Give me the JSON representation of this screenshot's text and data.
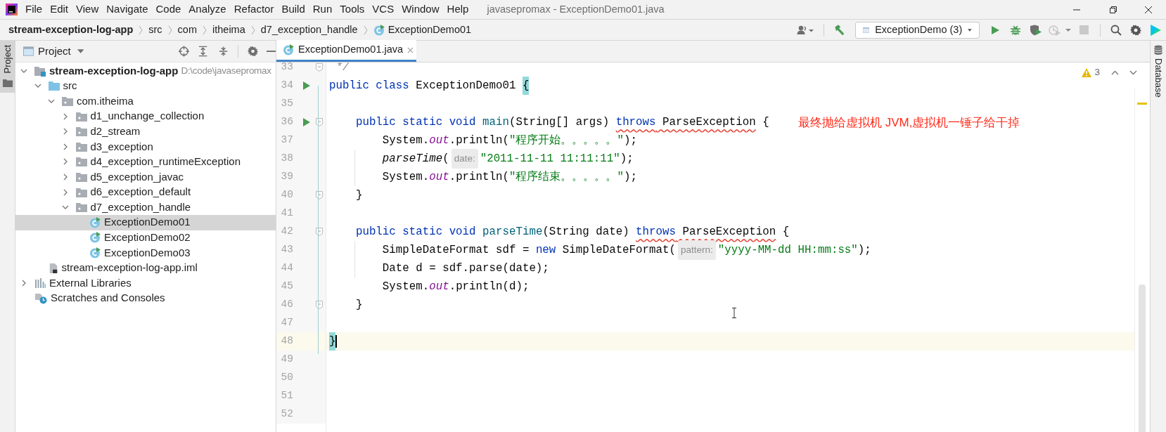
{
  "window": {
    "title": "javasepromax - ExceptionDemo01.java"
  },
  "menu": [
    "File",
    "Edit",
    "View",
    "Navigate",
    "Code",
    "Analyze",
    "Refactor",
    "Build",
    "Run",
    "Tools",
    "VCS",
    "Window",
    "Help"
  ],
  "breadcrumbs": [
    {
      "label": "stream-exception-log-app",
      "kind": "module"
    },
    {
      "label": "src",
      "kind": "folder"
    },
    {
      "label": "com",
      "kind": "folder"
    },
    {
      "label": "itheima",
      "kind": "folder"
    },
    {
      "label": "d7_exception_handle",
      "kind": "folder"
    },
    {
      "label": "ExceptionDemo01",
      "kind": "class"
    }
  ],
  "run_config": {
    "label": "ExceptionDemo (3)"
  },
  "side_tabs": {
    "left": "Project",
    "right": "Database"
  },
  "project_panel": {
    "title": "Project",
    "tree": [
      {
        "label": "stream-exception-log-app",
        "path": "D:\\code\\javasepromax",
        "kind": "module",
        "expanded": true,
        "selected": false,
        "children": [
          {
            "label": "src",
            "kind": "source_folder",
            "expanded": true,
            "selected": false,
            "children": [
              {
                "label": "com.itheima",
                "kind": "package",
                "expanded": true,
                "selected": false,
                "children": [
                  {
                    "label": "d1_unchange_collection",
                    "kind": "package",
                    "expanded": false,
                    "selected": false
                  },
                  {
                    "label": "d2_stream",
                    "kind": "package",
                    "expanded": false,
                    "selected": false
                  },
                  {
                    "label": "d3_exception",
                    "kind": "package",
                    "expanded": false,
                    "selected": false
                  },
                  {
                    "label": "d4_exception_runtimeException",
                    "kind": "package",
                    "expanded": false,
                    "selected": false
                  },
                  {
                    "label": "d5_exception_javac",
                    "kind": "package",
                    "expanded": false,
                    "selected": false
                  },
                  {
                    "label": "d6_exception_default",
                    "kind": "package",
                    "expanded": false,
                    "selected": false
                  },
                  {
                    "label": "d7_exception_handle",
                    "kind": "package",
                    "expanded": true,
                    "selected": false,
                    "children": [
                      {
                        "label": "ExceptionDemo01",
                        "kind": "class",
                        "selected": true
                      },
                      {
                        "label": "ExceptionDemo02",
                        "kind": "class",
                        "selected": false
                      },
                      {
                        "label": "ExceptionDemo03",
                        "kind": "class",
                        "selected": false
                      }
                    ]
                  }
                ]
              }
            ]
          },
          {
            "label": "stream-exception-log-app.iml",
            "kind": "iml",
            "selected": false
          }
        ]
      },
      {
        "label": "External Libraries",
        "kind": "libraries",
        "expanded": false,
        "selected": false
      },
      {
        "label": "Scratches and Consoles",
        "kind": "scratches",
        "selected": false
      }
    ]
  },
  "editor": {
    "tab": {
      "label": "ExceptionDemo01.java",
      "selected": true
    },
    "warnings": "3",
    "lines": [
      {
        "number": "33",
        "run": false,
        "fold": true,
        "current": false,
        "tokens": [
          {
            "kind": "comment",
            "text": " */"
          }
        ]
      },
      {
        "number": "34",
        "run": true,
        "fold": false,
        "current": false,
        "tokens": [
          {
            "kind": "keyword",
            "text": "public class "
          },
          {
            "kind": "plain",
            "text": "ExceptionDemo01 "
          },
          {
            "kind": "brace_match",
            "text": "{"
          }
        ]
      },
      {
        "number": "35",
        "run": false,
        "fold": false,
        "current": false
      },
      {
        "number": "36",
        "run": true,
        "fold": true,
        "current": false,
        "annotation": "最终抛给虚拟机 JVM,虚拟机一锤子给干掉",
        "tokens": [
          {
            "kind": "keyword",
            "text": "    public static void "
          },
          {
            "kind": "method_decl",
            "text": "main"
          },
          {
            "kind": "plain",
            "text": "(String[] args) "
          },
          {
            "kind": "flagged",
            "tokens": [
              {
                "kind": "keyword",
                "text": "throws"
              },
              {
                "kind": "plain",
                "text": " ParseException"
              }
            ]
          },
          {
            "kind": "plain",
            "text": " {"
          }
        ]
      },
      {
        "number": "37",
        "run": false,
        "fold": false,
        "current": false,
        "tokens": [
          {
            "kind": "plain",
            "text": "        System."
          },
          {
            "kind": "field",
            "text": "out"
          },
          {
            "kind": "plain",
            "text": ".println("
          },
          {
            "kind": "string",
            "text": "\"程序开始。。。。。\""
          },
          {
            "kind": "plain",
            "text": ");"
          }
        ]
      },
      {
        "number": "38",
        "run": false,
        "fold": false,
        "current": false,
        "tokens": [
          {
            "kind": "static_call",
            "text": "        parseTime"
          },
          {
            "kind": "plain",
            "text": "("
          },
          {
            "kind": "hint",
            "text": "date:"
          },
          {
            "kind": "string",
            "text": "\"2011-11-11 11:11:11\""
          },
          {
            "kind": "plain",
            "text": ");"
          }
        ]
      },
      {
        "number": "39",
        "run": false,
        "fold": false,
        "current": false,
        "tokens": [
          {
            "kind": "plain",
            "text": "        System."
          },
          {
            "kind": "field",
            "text": "out"
          },
          {
            "kind": "plain",
            "text": ".println("
          },
          {
            "kind": "string",
            "text": "\"程序结束。。。。。\""
          },
          {
            "kind": "plain",
            "text": ");"
          }
        ]
      },
      {
        "number": "40",
        "run": false,
        "fold": true,
        "current": false,
        "tokens": [
          {
            "kind": "plain",
            "text": "    }"
          }
        ]
      },
      {
        "number": "41",
        "run": false,
        "fold": false,
        "current": false
      },
      {
        "number": "42",
        "run": false,
        "fold": true,
        "current": false,
        "tokens": [
          {
            "kind": "keyword",
            "text": "    public static void "
          },
          {
            "kind": "method_decl",
            "text": "parseTime"
          },
          {
            "kind": "plain",
            "text": "(String date) "
          },
          {
            "kind": "flagged",
            "tokens": [
              {
                "kind": "keyword",
                "text": "throws"
              },
              {
                "kind": "plain",
                "text": " ParseException"
              }
            ]
          },
          {
            "kind": "plain",
            "text": " {"
          }
        ]
      },
      {
        "number": "43",
        "run": false,
        "fold": false,
        "current": false,
        "tokens": [
          {
            "kind": "plain",
            "text": "        SimpleDateFormat sdf = "
          },
          {
            "kind": "keyword",
            "text": "new"
          },
          {
            "kind": "plain",
            "text": " SimpleDateFormat("
          },
          {
            "kind": "hint",
            "text": "pattern:"
          },
          {
            "kind": "string",
            "text": "\"yyyy-MM-dd HH:mm:ss\""
          },
          {
            "kind": "plain",
            "text": ");"
          }
        ]
      },
      {
        "number": "44",
        "run": false,
        "fold": false,
        "current": false,
        "tokens": [
          {
            "kind": "plain",
            "text": "        Date d = sdf.parse(date);"
          }
        ]
      },
      {
        "number": "45",
        "run": false,
        "fold": false,
        "current": false,
        "tokens": [
          {
            "kind": "plain",
            "text": "        System."
          },
          {
            "kind": "field",
            "text": "out"
          },
          {
            "kind": "plain",
            "text": ".println(d);"
          }
        ]
      },
      {
        "number": "46",
        "run": false,
        "fold": true,
        "current": false,
        "tokens": [
          {
            "kind": "plain",
            "text": "    }"
          }
        ]
      },
      {
        "number": "47",
        "run": false,
        "fold": false,
        "current": false
      },
      {
        "number": "48",
        "run": false,
        "fold": false,
        "current": true,
        "tokens": [
          {
            "kind": "brace_match",
            "text": "}"
          }
        ]
      },
      {
        "number": "49",
        "run": false,
        "fold": false,
        "current": false
      },
      {
        "number": "50",
        "run": false,
        "fold": false,
        "current": false
      },
      {
        "number": "51",
        "run": false,
        "fold": false,
        "current": false
      },
      {
        "number": "52",
        "run": false,
        "fold": false,
        "current": false
      }
    ]
  }
}
